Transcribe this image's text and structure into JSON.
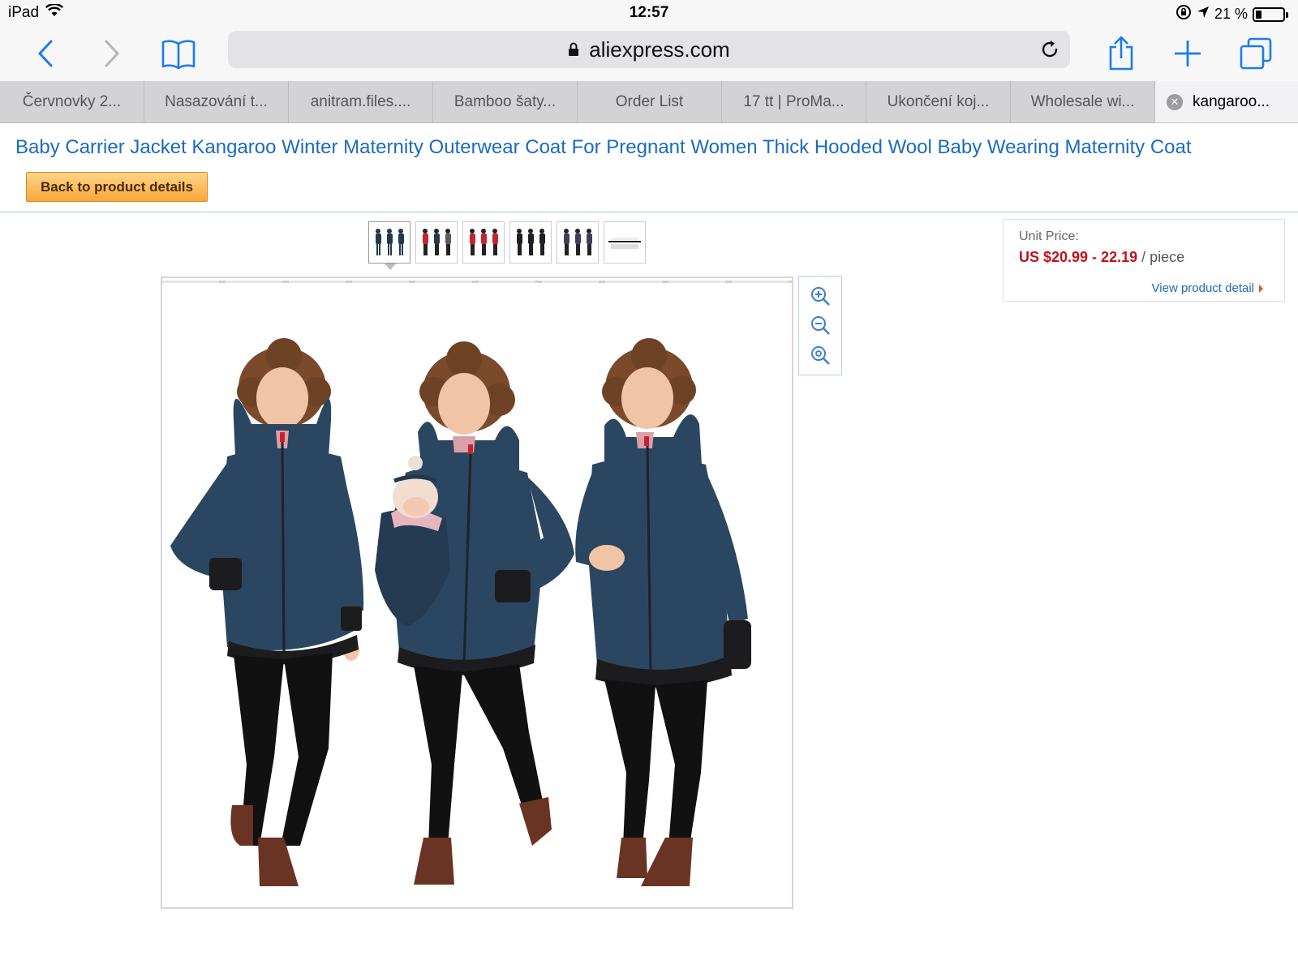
{
  "status_bar": {
    "device": "iPad",
    "time": "12:57",
    "battery": "21 %",
    "battery_level": 0.21
  },
  "browser": {
    "host": "aliexpress.com",
    "icons": [
      "back-icon",
      "forward-icon",
      "bookmarks-icon",
      "lock-icon",
      "reload-icon",
      "share-icon",
      "new-tab-icon",
      "tabs-icon"
    ]
  },
  "tabs": [
    {
      "label": "Červnovky 2..."
    },
    {
      "label": "Nasazování t..."
    },
    {
      "label": "anitram.files...."
    },
    {
      "label": "Bamboo šaty..."
    },
    {
      "label": "Order List"
    },
    {
      "label": "17 tt | ProMa..."
    },
    {
      "label": "Ukončení koj..."
    },
    {
      "label": "Wholesale wi..."
    },
    {
      "label": "kangaroo..."
    }
  ],
  "page": {
    "title": "Baby Carrier Jacket Kangaroo Winter Maternity Outerwear Coat For Pregnant Women Thick Hooded Wool Baby Wearing Maternity Coat",
    "back_button": "Back to product details",
    "price": {
      "label": "Unit Price:",
      "amount": "US $20.99 - 22.19",
      "unit": " / piece",
      "view_link": "View product detail"
    }
  },
  "colors": {
    "link_blue": "#1a6bc1",
    "price_red": "#c1121c",
    "ios_blue": "#1a7cf0",
    "coat_navy": "#2b4660"
  }
}
